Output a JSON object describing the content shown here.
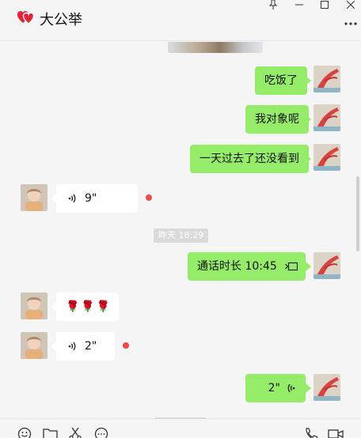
{
  "header": {
    "title": "大公举",
    "logo_icon": "double-heart-icon",
    "window_controls": [
      "pin-icon",
      "minimize-icon",
      "maximize-icon",
      "close-icon"
    ],
    "more_icon": "more-dots-icon"
  },
  "messages": [
    {
      "side": "me",
      "type": "text",
      "text": "吃饭了"
    },
    {
      "side": "me",
      "type": "text",
      "text": "我对象呢"
    },
    {
      "side": "me",
      "type": "text",
      "text": "一天过去了还没看到"
    },
    {
      "side": "them",
      "type": "voice",
      "duration": "9\"",
      "unread": true
    },
    {
      "type": "time",
      "text": "昨天 18:29"
    },
    {
      "side": "me",
      "type": "call",
      "text": "通话时长 10:45"
    },
    {
      "side": "them",
      "type": "emoji",
      "text": "🌹🌹🌹"
    },
    {
      "side": "them",
      "type": "voice",
      "duration": "2\"",
      "unread": true
    },
    {
      "side": "me",
      "type": "voice",
      "duration": "2\""
    }
  ],
  "toolbar": {
    "icons": [
      "emoji-icon",
      "folder-icon",
      "scissors-icon",
      "chat-history-icon",
      "phone-icon",
      "video-call-icon"
    ]
  },
  "colors": {
    "my_bubble": "#95ec69",
    "their_bubble": "#ffffff",
    "unread_dot": "#f04a4a",
    "background": "#f5f5f5"
  }
}
